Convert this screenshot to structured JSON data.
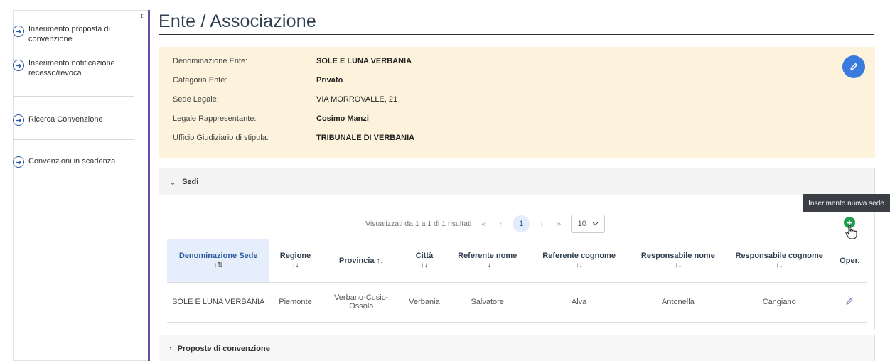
{
  "sidebar": {
    "items": [
      {
        "label": "Inserimento proposta di convenzione",
        "line1": "Inserimento proposta di",
        "line2": "convenzione"
      },
      {
        "label": "Inserimento notificazione recesso/revoca",
        "line1": "Inserimento notificazione",
        "line2": "recesso/revoca"
      },
      {
        "label": "Ricerca Convenzione",
        "line1": "Ricerca Convenzione",
        "line2": ""
      },
      {
        "label": "Convenzioni in scadenza",
        "line1": "Convenzioni in scadenza",
        "line2": ""
      }
    ],
    "collapse_icon": "‹"
  },
  "page": {
    "title": "Ente / Associazione"
  },
  "info": {
    "rows": [
      {
        "label": "Denominazione Ente:",
        "value": "SOLE E LUNA VERBANIA"
      },
      {
        "label": "Categoria Ente:",
        "value": "Privato"
      },
      {
        "label": "Sede Legale:",
        "value": "VIA MORROVALLE, 21"
      },
      {
        "label": "Legale Rappresentante:",
        "value": "Cosimo Manzi"
      },
      {
        "label": "Ufficio Giudiziario di stipula:",
        "value": "TRIBUNALE DI VERBANIA"
      }
    ]
  },
  "sedi": {
    "header": "Sedi",
    "pager": {
      "summary": "Visualizzati da 1 a 1 di 1 risultati",
      "first": "«",
      "prev": "‹",
      "current": "1",
      "next": "›",
      "last": "»",
      "page_size": "10"
    },
    "tooltip": "Inserimento nuova sede",
    "add_symbol": "+",
    "columns": [
      {
        "label": "Denominazione Sede",
        "sort": "↑⇅"
      },
      {
        "label": "Regione",
        "sort": "↑↓"
      },
      {
        "label": "Provincia",
        "sort": "↑↓"
      },
      {
        "label": "Città",
        "sort": "↑↓"
      },
      {
        "label": "Referente nome",
        "sort": "↑↓"
      },
      {
        "label": "Referente cognome",
        "sort": "↑↓"
      },
      {
        "label": "Responsabile nome",
        "sort": "↑↓"
      },
      {
        "label": "Responsabile cognome",
        "sort": "↑↓"
      },
      {
        "label": "Oper.",
        "sort": ""
      }
    ],
    "rows": [
      {
        "denominazione": "SOLE E LUNA VERBANIA",
        "regione": "Piemonte",
        "provincia_l1": "Verbano-Cusio-",
        "provincia_l2": "Ossola",
        "citta": "Verbania",
        "ref_nome": "Salvatore",
        "ref_cognome": "Alva",
        "resp_nome": "Antonella",
        "resp_cognome": "Cangiano"
      }
    ]
  },
  "proposte": {
    "header": "Proposte di convenzione"
  },
  "colors": {
    "accent": "#3a7be0",
    "sidebar_rule": "#6b4aa8",
    "panel_bg": "#fdf3dc",
    "add_green": "#1e9e4a"
  }
}
